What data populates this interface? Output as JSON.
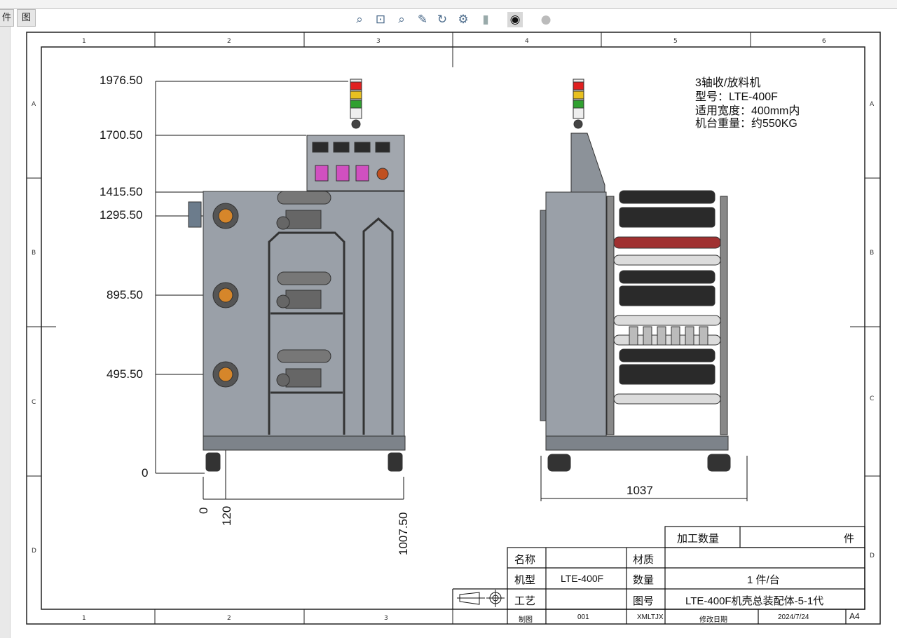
{
  "toolbar": {
    "partial_items": [
      "",
      "",
      "",
      ""
    ]
  },
  "tabs": [
    {
      "label": "件"
    },
    {
      "label": "图纸格式"
    }
  ],
  "view_toolbar": {
    "icons": [
      "zoom-to-fit-icon",
      "zoom-to-area-icon",
      "zoom-in-out-icon",
      "select-icon",
      "rotate-icon",
      "display-style-icon",
      "hide-show-icon",
      "view-settings-icon",
      "apply-scene-icon"
    ]
  },
  "frame": {
    "col_labels": [
      "1",
      "2",
      "3",
      "4",
      "5",
      "6"
    ],
    "row_labels": [
      "A",
      "B",
      "C",
      "D"
    ]
  },
  "drawing": {
    "info": {
      "line1": "3轴收/放料机",
      "line2": "型号：LTE-400F",
      "line3": "适用宽度：400mm内",
      "line4": "机台重量：约550KG"
    },
    "dims_vertical": [
      "1976.50",
      "1700.50",
      "1415.50",
      "1295.50",
      "895.50",
      "495.50",
      "0"
    ],
    "dims_horizontal": [
      "0",
      "120",
      "1007.50"
    ],
    "dim_width": "1037"
  },
  "title_block": {
    "qty_label": "加工数量",
    "qty_unit": "件",
    "name_label": "名称",
    "name_value": "",
    "material_label": "材质",
    "material_value": "",
    "model_label": "机型",
    "model_value": "LTE-400F",
    "count_label": "数量",
    "count_value": "1 件/台",
    "process_label": "工艺",
    "process_value": "",
    "dwg_label": "图号",
    "dwg_value": "LTE-400F机壳总装配体-5-1代",
    "drawn_label": "制图",
    "drawn_value": "001",
    "drawn_by": "XMLTJX",
    "rev_label": "修改日期",
    "rev_date": "2024/7/24",
    "sheet_size": "A4"
  },
  "colors": {
    "machine_body": "#9aa0a8",
    "roller_dark": "#2a2a2a",
    "hub_orange": "#d6862a",
    "signal_red": "#e02020",
    "signal_yellow": "#e8c020",
    "signal_green": "#30a030"
  }
}
